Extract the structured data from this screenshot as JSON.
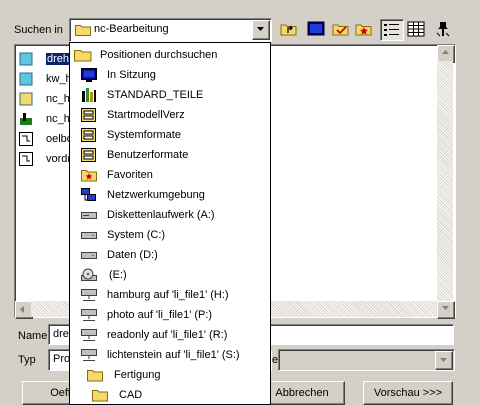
{
  "lookin": {
    "label": "Suchen in",
    "value": "nc-Bearbeitung"
  },
  "toolbar": {
    "icons": [
      "up-folder-icon",
      "desktop-icon",
      "folder-check-icon",
      "folder-star-icon",
      "list-view-icon",
      "details-view-icon",
      "pin-icon"
    ]
  },
  "files": [
    {
      "name": "dreh_",
      "icon": "cube-icon",
      "selected": true
    },
    {
      "name": "kw_h",
      "icon": "cube-icon"
    },
    {
      "name": "nc_h",
      "icon": "cube-icon"
    },
    {
      "name": "nc_h",
      "icon": "nc-program-icon"
    },
    {
      "name": "oelbo",
      "icon": "drawing-icon"
    },
    {
      "name": "vordr",
      "icon": "drawing-icon"
    }
  ],
  "dropdown": {
    "items": [
      {
        "label": "Positionen durchsuchen",
        "icon": "folder-icon"
      },
      {
        "label": "In Sitzung",
        "icon": "monitor-icon"
      },
      {
        "label": "STANDARD_TEILE",
        "icon": "library-icon"
      },
      {
        "label": "StartmodellVerz",
        "icon": "cabinet-icon"
      },
      {
        "label": "Systemformate",
        "icon": "cabinet-icon"
      },
      {
        "label": "Benutzerformate",
        "icon": "cabinet-icon"
      },
      {
        "label": "Favoriten",
        "icon": "favorites-folder-icon"
      },
      {
        "label": "Netzwerkumgebung",
        "icon": "network-icon"
      },
      {
        "label": "Diskettenlaufwerk (A:)",
        "icon": "drive-icon"
      },
      {
        "label": "System (C:)",
        "icon": "drive-icon"
      },
      {
        "label": "Daten (D:)",
        "icon": "drive-icon"
      },
      {
        "label": "(E:)",
        "icon": "cd-drive-icon"
      },
      {
        "label": "hamburg auf 'li_file1' (H:)",
        "icon": "network-drive-icon"
      },
      {
        "label": "photo auf 'li_file1' (P:)",
        "icon": "network-drive-icon"
      },
      {
        "label": "readonly auf 'li_file1' (R:)",
        "icon": "network-drive-icon"
      },
      {
        "label": "lichtenstein auf 'li_file1' (S:)",
        "icon": "network-drive-icon"
      },
      {
        "label": "Fertigung",
        "icon": "folder-icon"
      },
      {
        "label": "CAD",
        "icon": "folder-icon"
      }
    ]
  },
  "name_field": {
    "label": "Name",
    "value": "dreh"
  },
  "type_field": {
    "label": "Typ",
    "value": "Pro",
    "suffix": "e"
  },
  "buttons": {
    "open": "Oeff",
    "cancel": "Abbrechen",
    "preview": "Vorschau >>>"
  },
  "colors": {
    "background": "#d4d0c8",
    "selection": "#0a246a",
    "folder": "#f5d96b"
  }
}
